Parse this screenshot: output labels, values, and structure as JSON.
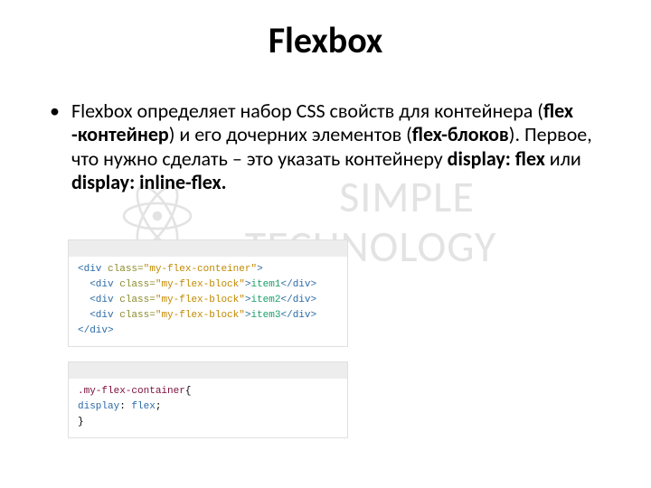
{
  "title": "Flexbox",
  "bullet_text": {
    "pre1": "Flexbox определяет набор CSS свойств для контейнера (",
    "bold1": "flex -контейнер",
    "mid1": ") и его дочерних элементов (",
    "bold2": "flex-блоков",
    "mid2": "). Первое, что нужно сделать – это указать контейнеру ",
    "bold3": "display: flex",
    "mid3": " или ",
    "bold4": "display: inline-flex.",
    "end": ""
  },
  "code_html": {
    "class_container": "my-flex-conteiner",
    "class_block": "my-flex-block",
    "items": [
      "item1",
      "item2",
      "item3"
    ]
  },
  "code_css": {
    "selector": ".my-flex-container",
    "prop": "display",
    "value": "flex"
  },
  "watermark": {
    "line1": "SIMPLE",
    "line2": "TECHNOLOGY"
  }
}
